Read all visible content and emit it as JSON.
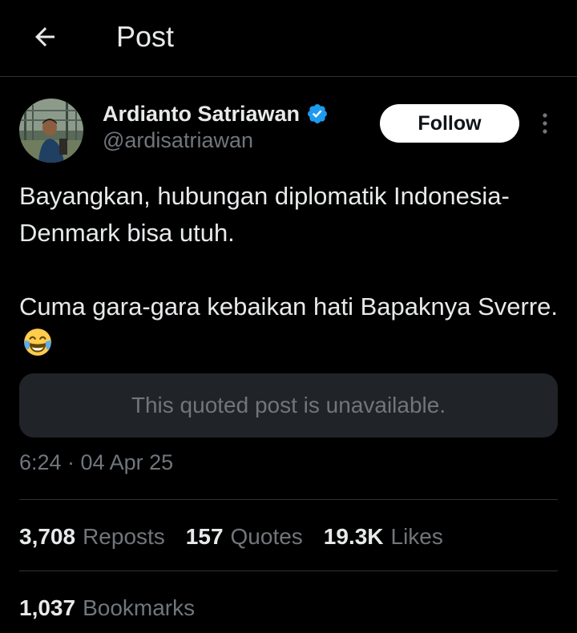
{
  "header": {
    "title": "Post",
    "back_icon": "arrow-left-icon"
  },
  "author": {
    "name": "Ardianto Satriawan",
    "handle": "@ardisatriawan",
    "verified": true,
    "verified_color": "#1d9bf0"
  },
  "follow_label": "Follow",
  "more_icon": "vertical-ellipsis-icon",
  "tweet": {
    "paragraphs": [
      "Bayangkan, hubungan diplomatik Indonesia-Denmark bisa utuh.",
      "Cuma gara-gara kebaikan hati Bapaknya Sverre."
    ],
    "emoji": "face-with-tears-of-joy"
  },
  "quoted_post": {
    "text": "This quoted post is unavailable."
  },
  "timestamp": "6:24 · 04 Apr 25",
  "stats": {
    "reposts_value": "3,708",
    "reposts_label": "Reposts",
    "quotes_value": "157",
    "quotes_label": "Quotes",
    "likes_value": "19.3K",
    "likes_label": "Likes",
    "bookmarks_value": "1,037",
    "bookmarks_label": "Bookmarks"
  },
  "colors": {
    "background": "#000000",
    "text_primary": "#e7e9ea",
    "text_secondary": "#71767b",
    "divider": "#2f3336",
    "quote_box": "#202327",
    "accent": "#1d9bf0"
  }
}
